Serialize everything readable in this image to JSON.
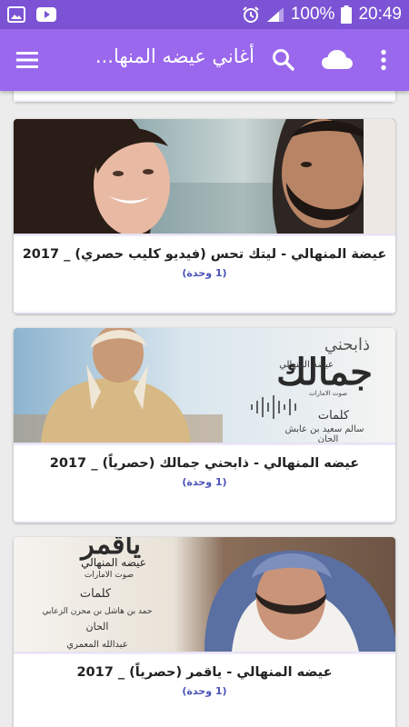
{
  "status_bar": {
    "battery": "100%",
    "time": "20:49",
    "icons": [
      "image-icon",
      "youtube-icon",
      "alarm-icon",
      "signal-icon",
      "battery-icon"
    ]
  },
  "app_bar": {
    "title": "أغاني عيضه المنها...",
    "icons": [
      "menu-icon",
      "search-icon",
      "cloud-icon",
      "more-vert-icon"
    ],
    "accent": "#9a68ec",
    "status_color": "#7b53d4"
  },
  "videos": [
    {
      "title": "عيضة المنهالي - ليتك تحس (فيديو كليب حصري) _ 2017",
      "count": "(1 وحدة)"
    },
    {
      "title": "عيضه المنهالي - ذابحني جمالك (حصرياً) _ 2017",
      "count": "(1 وحدة)",
      "thumb_text": {
        "top": "ذابحني",
        "big": "جمالك",
        "artist": "عيضه المنهالي",
        "label": "صوت الامارات",
        "lyrics_label": "كلمات",
        "lyricist": "سالم سعيد بن عابش",
        "composer_label": "الحان"
      }
    },
    {
      "title": "عيضه المنهالي - ياقمر (حصرياً) _ 2017",
      "count": "(1 وحدة)",
      "thumb_text": {
        "big": "ياقمر",
        "artist": "عيضه المنهالي",
        "label": "صوت الامارات",
        "lyrics_label": "كلمات",
        "lyricist": "حمد بن هاشل بن محرن الزعابي",
        "composer_label": "الحان",
        "composer": "عبدالله المعمري"
      }
    }
  ]
}
